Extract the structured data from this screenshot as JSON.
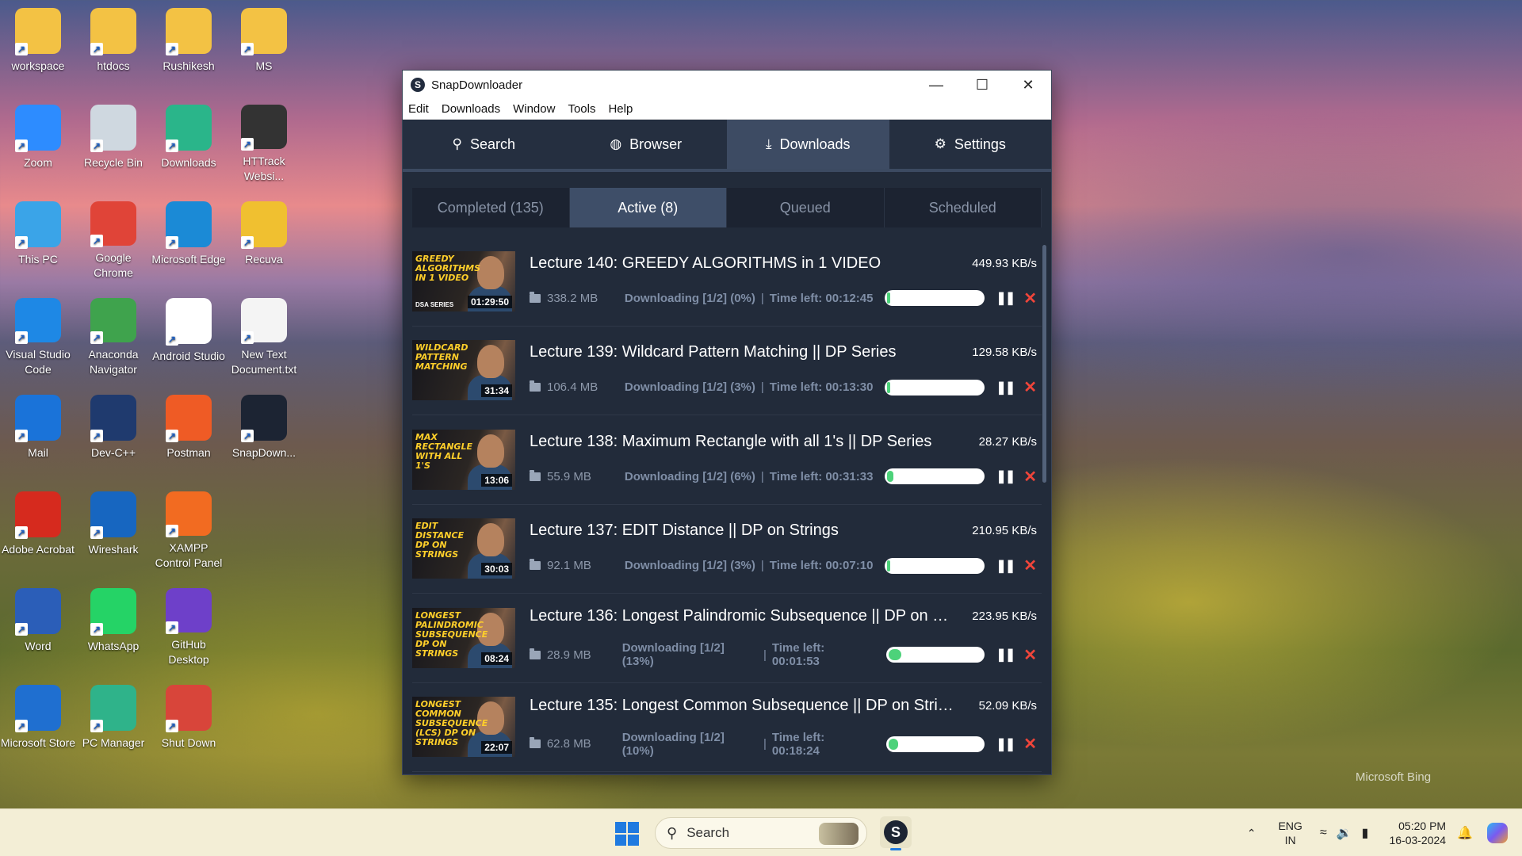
{
  "desktop": {
    "icons": [
      {
        "label": "workspace",
        "icon": "folder-icon",
        "color": "#f3c244"
      },
      {
        "label": "htdocs",
        "icon": "folder-icon",
        "color": "#f3c244"
      },
      {
        "label": "Rushikesh",
        "icon": "user-folder-icon",
        "color": "#f3c244"
      },
      {
        "label": "MS",
        "icon": "folder-icon",
        "color": "#f3c244"
      },
      {
        "label": "Zoom",
        "icon": "zoom-icon",
        "color": "#2d8cff"
      },
      {
        "label": "Recycle Bin",
        "icon": "recycle-bin-icon",
        "color": "#cfd8e0"
      },
      {
        "label": "Downloads",
        "icon": "downloads-folder-icon",
        "color": "#2ab58a"
      },
      {
        "label": "HTTrack Websi...",
        "icon": "httrack-icon",
        "color": "#333333"
      },
      {
        "label": "This PC",
        "icon": "monitor-icon",
        "color": "#3aa4e8"
      },
      {
        "label": "Google Chrome",
        "icon": "chrome-icon",
        "color": "#e04438"
      },
      {
        "label": "Microsoft Edge",
        "icon": "edge-icon",
        "color": "#1b8ad6"
      },
      {
        "label": "Recuva",
        "icon": "recuva-icon",
        "color": "#f0c030"
      },
      {
        "label": "Visual Studio Code",
        "icon": "vscode-icon",
        "color": "#1e88e5"
      },
      {
        "label": "Anaconda Navigator",
        "icon": "anaconda-icon",
        "color": "#3fa34d"
      },
      {
        "label": "Android Studio",
        "icon": "android-studio-icon",
        "color": "#ffffff"
      },
      {
        "label": "New Text Document.txt",
        "icon": "text-file-icon",
        "color": "#f4f4f4"
      },
      {
        "label": "Mail",
        "icon": "mail-icon",
        "color": "#1a73d9"
      },
      {
        "label": "Dev-C++",
        "icon": "devcpp-icon",
        "color": "#1f3a6e"
      },
      {
        "label": "Postman",
        "icon": "postman-icon",
        "color": "#ef5b25"
      },
      {
        "label": "SnapDown...",
        "icon": "snapdownloader-icon",
        "color": "#1c2433"
      },
      {
        "label": "Adobe Acrobat",
        "icon": "acrobat-icon",
        "color": "#d62a1e"
      },
      {
        "label": "Wireshark",
        "icon": "wireshark-icon",
        "color": "#1766c0"
      },
      {
        "label": "XAMPP Control Panel",
        "icon": "xampp-icon",
        "color": "#f26b21"
      },
      {
        "label": "",
        "icon": "blank-icon",
        "color": "transparent"
      },
      {
        "label": "Word",
        "icon": "word-icon",
        "color": "#2b5eb8"
      },
      {
        "label": "WhatsApp",
        "icon": "whatsapp-icon",
        "color": "#25d366"
      },
      {
        "label": "GitHub Desktop",
        "icon": "github-icon",
        "color": "#6e40c9"
      },
      {
        "label": "",
        "icon": "blank-icon",
        "color": "transparent"
      },
      {
        "label": "Microsoft Store",
        "icon": "store-icon",
        "color": "#1f6fd0"
      },
      {
        "label": "PC Manager",
        "icon": "pc-manager-icon",
        "color": "#2fb38a"
      },
      {
        "label": "Shut Down",
        "icon": "power-icon",
        "color": "#d8453a"
      }
    ]
  },
  "window": {
    "title": "SnapDownloader",
    "app_icon_letter": "S",
    "menu": [
      "Edit",
      "Downloads",
      "Window",
      "Tools",
      "Help"
    ],
    "nav_tabs": [
      {
        "label": "Search",
        "icon": "search-icon",
        "glyph": "⚲"
      },
      {
        "label": "Browser",
        "icon": "globe-icon",
        "glyph": "◍"
      },
      {
        "label": "Downloads",
        "icon": "download-icon",
        "glyph": "⤓"
      },
      {
        "label": "Settings",
        "icon": "gear-icon",
        "glyph": "⚙"
      }
    ],
    "active_nav": "Downloads",
    "sub_tabs": [
      "Completed (135)",
      "Active (8)",
      "Queued",
      "Scheduled"
    ],
    "active_sub_tab": "Active (8)",
    "downloads": [
      {
        "thumb_text": "Greedy Algorithms in 1 Video",
        "thumb_sub": "DSA SERIES",
        "duration": "01:29:50",
        "title": "Lecture 140: GREEDY ALGORITHMS in 1 VIDEO",
        "speed": "449.93 KB/s",
        "size": "338.2 MB",
        "status": "Downloading [1/2] (0%)",
        "time_left": "Time left: 00:12:45",
        "progress": 0.0
      },
      {
        "thumb_text": "Wildcard Pattern Matching",
        "thumb_sub": "",
        "duration": "31:34",
        "title": "Lecture 139: Wildcard Pattern Matching || DP Series",
        "speed": "129.58 KB/s",
        "size": "106.4 MB",
        "status": "Downloading [1/2] (3%)",
        "time_left": "Time left: 00:13:30",
        "progress": 0.03
      },
      {
        "thumb_text": "Max Rectangle with all 1's",
        "thumb_sub": "",
        "duration": "13:06",
        "title": "Lecture 138: Maximum Rectangle with all 1's || DP Series",
        "speed": "28.27 KB/s",
        "size": "55.9 MB",
        "status": "Downloading [1/2] (6%)",
        "time_left": "Time left: 00:31:33",
        "progress": 0.06
      },
      {
        "thumb_text": "Edit Distance DP on Strings",
        "thumb_sub": "",
        "duration": "30:03",
        "title": "Lecture 137: EDIT Distance || DP on Strings",
        "speed": "210.95 KB/s",
        "size": "92.1 MB",
        "status": "Downloading [1/2] (3%)",
        "time_left": "Time left: 00:07:10",
        "progress": 0.03
      },
      {
        "thumb_text": "Longest Palindromic Subsequence DP on Strings",
        "thumb_sub": "",
        "duration": "08:24",
        "title": "Lecture 136: Longest Palindromic Subsequence || DP on St...",
        "speed": "223.95 KB/s",
        "size": "28.9 MB",
        "status": "Downloading [1/2] (13%)",
        "time_left": "Time left: 00:01:53",
        "progress": 0.13
      },
      {
        "thumb_text": "Longest Common Subsequence (LCS) DP on Strings",
        "thumb_sub": "",
        "duration": "22:07",
        "title": "Lecture 135: Longest Common Subsequence || DP on Strin...",
        "speed": "52.09 KB/s",
        "size": "62.8 MB",
        "status": "Downloading [1/2] (10%)",
        "time_left": "Time left: 00:18:24",
        "progress": 0.1
      }
    ]
  },
  "taskbar": {
    "search_placeholder": "Search",
    "lang_line1": "ENG",
    "lang_line2": "IN",
    "time": "05:20 PM",
    "date": "16-03-2024"
  },
  "wallpaper_credit": "Microsoft Bing"
}
